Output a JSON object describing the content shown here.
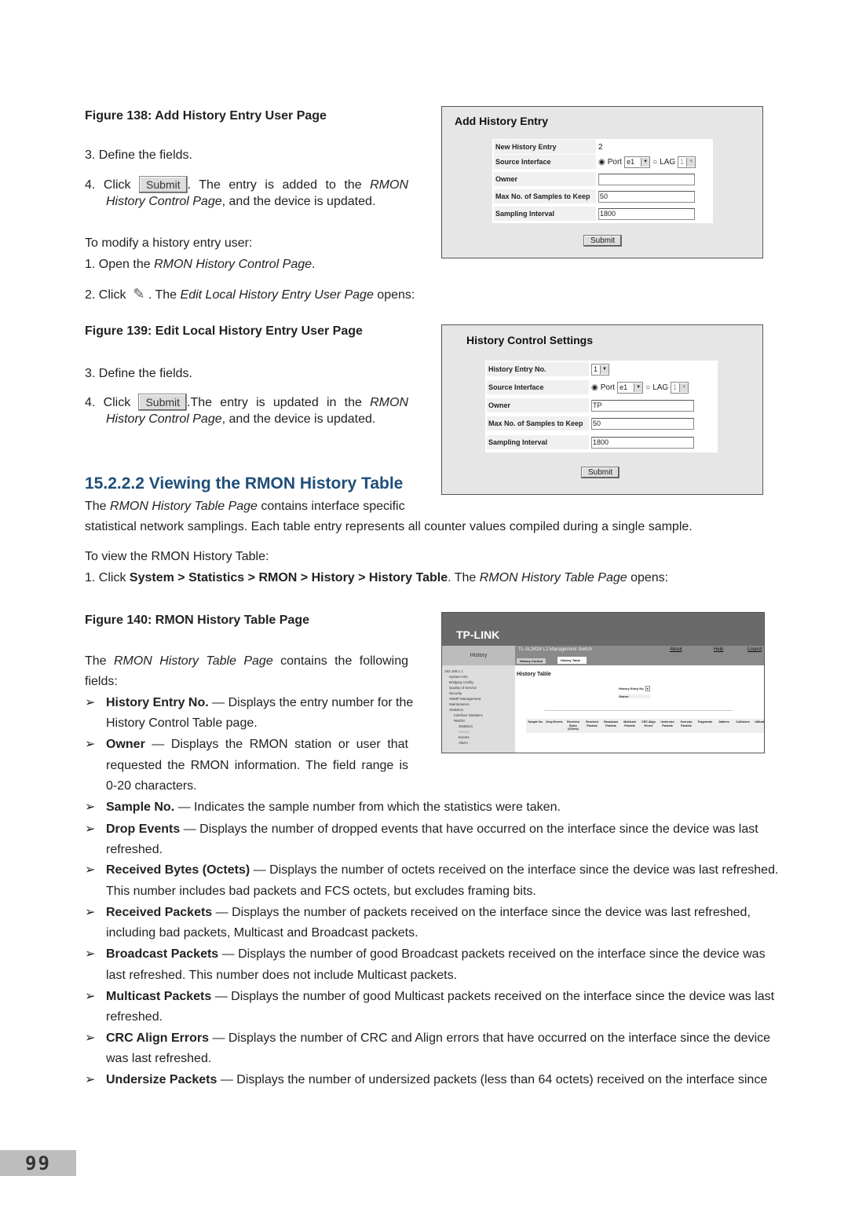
{
  "fig138": {
    "caption": "Figure 138: Add History Entry User Page",
    "step3": "3.  Define the fields.",
    "step4_a": "4.  Click ",
    "submit": "Submit",
    "step4_b": ". The entry is added to the ",
    "rmon": "RMON",
    "step4_c": "History Control Page",
    "step4_d": ", and the device is updated."
  },
  "modify": {
    "intro": "To modify a history entry user:",
    "s1_a": "1.  Open the ",
    "s1_b": "RMON History Control Page",
    "s1_c": ".",
    "s2_a": "2.  Click ",
    "s2_b": ". The ",
    "s2_c": "Edit Local History Entry User Page",
    "s2_d": " opens:",
    "icon": "pencil-edit-icon"
  },
  "fig139": {
    "caption": "Figure 139: Edit Local History Entry User Page",
    "step3": "3.  Define the fields.",
    "step4_a": "4.  Click ",
    "submit": "Submit",
    "step4_b": ".The entry is updated in the ",
    "rmon": "RMON",
    "step4_c": "History Control Page",
    "step4_d": ", and the device is updated."
  },
  "add_panel": {
    "title": "Add History Entry",
    "rows": [
      "New History Entry",
      "Source Interface",
      "Owner",
      "Max No. of Samples to Keep",
      "Sampling Interval"
    ],
    "entry": "2",
    "port_label": "Port",
    "port": "e1",
    "lag_label": "LAG",
    "lag": "1",
    "owner": "",
    "max_samples": "50",
    "interval": "1800",
    "submit": "Submit"
  },
  "edit_panel": {
    "title": "History Control Settings",
    "rows": [
      "History Entry No.",
      "Source Interface",
      "Owner",
      "Max No. of Samples to Keep",
      "Sampling Interval"
    ],
    "entry": "1",
    "port_label": "Port",
    "port": "e1",
    "lag_label": "LAG",
    "lag": "1",
    "owner": "TP",
    "max_samples": "50",
    "interval": "1800",
    "submit": "Submit"
  },
  "section": {
    "heading": "15.2.2.2  Viewing the RMON History Table",
    "p1_a": "The ",
    "p1_b": "RMON History Table Page",
    "p1_c": " contains interface specific",
    "p2": "statistical network samplings. Each table entry represents all counter values compiled during a single sample.",
    "view": "To view the RMON History Table:",
    "c_a": "1.  Click ",
    "c_path": [
      "System",
      "Statistics",
      "RMON",
      "History",
      "History Table"
    ],
    "sep": " > ",
    "c_b": ". The ",
    "c_c": "RMON History Table Page",
    "c_d": " opens:"
  },
  "fig140": {
    "caption": "Figure 140: RMON History Table Page",
    "f1_a": "The ",
    "f1_b": "RMON History Table Page",
    "f1_c": " contains the following",
    "f2": "fields:"
  },
  "tplink": {
    "logo": "TP-LINK",
    "section": "History",
    "product": "TL-SL3428 L2 Management Switch",
    "links": [
      "About",
      "Help",
      "Logout"
    ],
    "tabs": [
      "History Control",
      "History Table"
    ],
    "tree": [
      "192.168.1.1",
      "System Info",
      "Bridging Config",
      "Quality of Service",
      "Security",
      "SNMP Management",
      "Maintenance",
      "Statistics",
      "Interface Statistics",
      "RMON",
      "Statistics",
      "History",
      "Events",
      "Alarm"
    ],
    "title": "History Table",
    "entry_label": "History Entry No.",
    "owner_label": "Owner",
    "columns": [
      "Sample No.",
      "Drop Events",
      "Received Bytes (Octets)",
      "Received Packets",
      "Broadcast Packets",
      "Multicast Packets",
      "CRC Align Errors",
      "Undersize Packets",
      "Oversize Packets",
      "Fragments",
      "Jabbers",
      "Collisions",
      "Utilization"
    ]
  },
  "fields": [
    {
      "term": "History Entry No.",
      "lines": [
        " — Displays the entry number for the",
        "History Control Table page."
      ]
    },
    {
      "term": "Owner",
      "lines": [
        " — Displays the RMON station or user that",
        "requested the RMON information. The field range is",
        "0-20 characters."
      ]
    },
    {
      "term": "Sample No.",
      "lines": [
        " — Indicates the sample number from which the statistics were taken."
      ]
    },
    {
      "term": "Drop Events",
      "lines": [
        " — Displays the number of dropped events that have occurred on the interface since the device was last",
        "refreshed."
      ]
    },
    {
      "term": "Received Bytes (Octets)",
      "lines": [
        " — Displays the number of octets received on the interface since the device was last refreshed.",
        "This number includes bad packets and FCS octets, but excludes framing bits."
      ]
    },
    {
      "term": "Received Packets",
      "lines": [
        " — Displays the number of packets received on the interface since the device was last refreshed,",
        "including bad packets, Multicast and Broadcast packets."
      ]
    },
    {
      "term": "Broadcast Packets",
      "lines": [
        " — Displays the number of good Broadcast packets received on the interface since the device was",
        "last refreshed. This number does not include Multicast packets."
      ]
    },
    {
      "term": "Multicast Packets",
      "lines": [
        " — Displays the number of good Multicast packets received on the interface since the device was last",
        "refreshed."
      ]
    },
    {
      "term": "CRC Align Errors",
      "lines": [
        " — Displays the number of CRC and Align errors that have occurred on the interface since the device",
        "was last refreshed."
      ]
    },
    {
      "term": "Undersize Packets",
      "lines": [
        " — Displays the number of undersized packets (less than 64 octets) received on the interface since"
      ]
    }
  ],
  "bullet": "➢",
  "page_number": "99"
}
